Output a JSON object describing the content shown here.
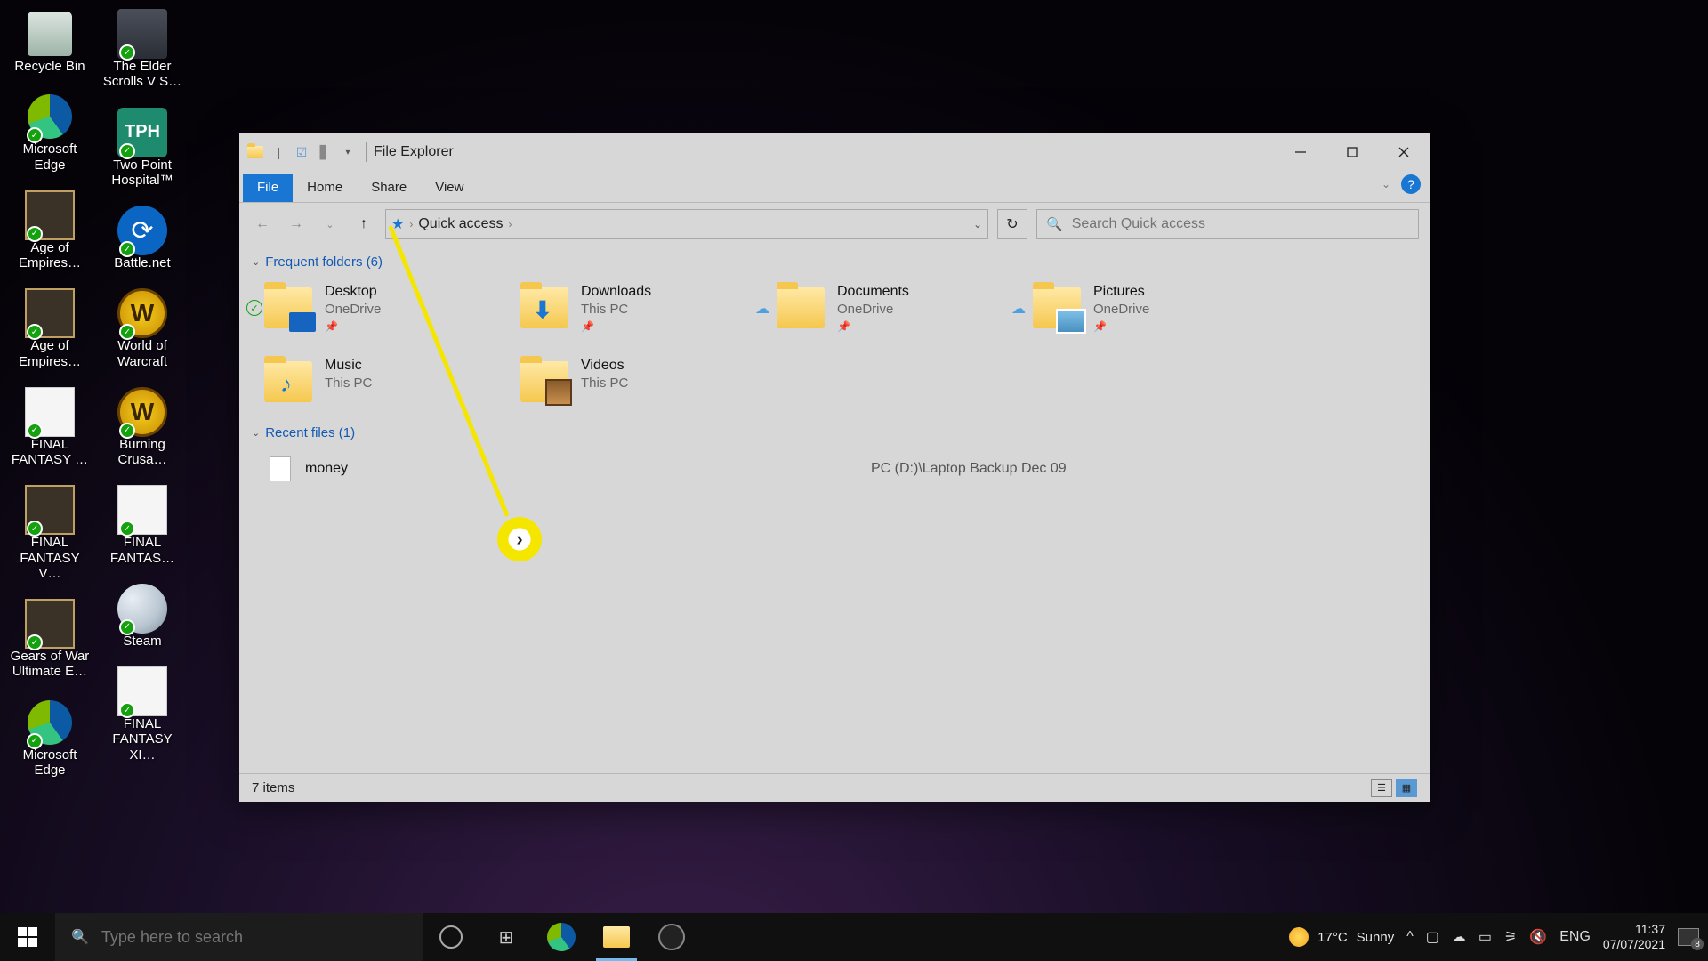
{
  "desktop": {
    "icons": [
      {
        "label": "Recycle Bin",
        "kind": "recycle",
        "badge": false
      },
      {
        "label": "Microsoft Edge",
        "kind": "edge",
        "badge": true
      },
      {
        "label": "Age of Empires…",
        "kind": "shot",
        "badge": true
      },
      {
        "label": "Age of Empires…",
        "kind": "shot",
        "badge": true
      },
      {
        "label": "FINAL FANTASY …",
        "kind": "white",
        "badge": true
      },
      {
        "label": "FINAL FANTASY V…",
        "kind": "shot",
        "badge": true
      },
      {
        "label": "Gears of War Ultimate E…",
        "kind": "shot",
        "badge": true
      },
      {
        "label": "Microsoft Edge",
        "kind": "edge",
        "badge": true
      },
      {
        "label": "The Elder Scrolls V S…",
        "kind": "tile",
        "badge": true
      },
      {
        "label": "Two Point Hospital™",
        "kind": "tph",
        "badge": true
      },
      {
        "label": "Battle.net",
        "kind": "bnet",
        "badge": true
      },
      {
        "label": "World of Warcraft",
        "kind": "wow",
        "badge": true
      },
      {
        "label": "Burning Crusa…",
        "kind": "wow",
        "badge": true
      },
      {
        "label": "FINAL FANTAS…",
        "kind": "white",
        "badge": true
      },
      {
        "label": "Steam",
        "kind": "steam",
        "badge": true
      },
      {
        "label": "FINAL FANTASY XI…",
        "kind": "white",
        "badge": true
      }
    ]
  },
  "window": {
    "title": "File Explorer",
    "ribbon": {
      "file": "File",
      "home": "Home",
      "share": "Share",
      "view": "View",
      "help": "?"
    },
    "nav": {
      "location": "Quick access",
      "search_placeholder": "Search Quick access"
    },
    "groups": {
      "frequent": {
        "label": "Frequent folders (6)"
      },
      "recent": {
        "label": "Recent files (1)"
      }
    },
    "folders": [
      {
        "name": "Desktop",
        "loc": "OneDrive",
        "style": "desk",
        "pin": true,
        "sync": "check"
      },
      {
        "name": "Downloads",
        "loc": "This PC",
        "style": "dl",
        "pin": true,
        "sync": null
      },
      {
        "name": "Documents",
        "loc": "OneDrive",
        "style": "plain",
        "pin": true,
        "sync": "cloud"
      },
      {
        "name": "Pictures",
        "loc": "OneDrive",
        "style": "pics",
        "pin": true,
        "sync": "cloud"
      },
      {
        "name": "Music",
        "loc": "This PC",
        "style": "music",
        "pin": false,
        "sync": null
      },
      {
        "name": "Videos",
        "loc": "This PC",
        "style": "video",
        "pin": false,
        "sync": null
      }
    ],
    "recent_file": {
      "name": "money",
      "path": "PC (D:)\\Laptop Backup Dec 09"
    },
    "status": "7 items"
  },
  "taskbar": {
    "search_placeholder": "Type here to search",
    "weather": {
      "temp": "17°C",
      "cond": "Sunny"
    },
    "lang": "ENG",
    "time": "11:37",
    "date": "07/07/2021",
    "notifications": "8"
  }
}
